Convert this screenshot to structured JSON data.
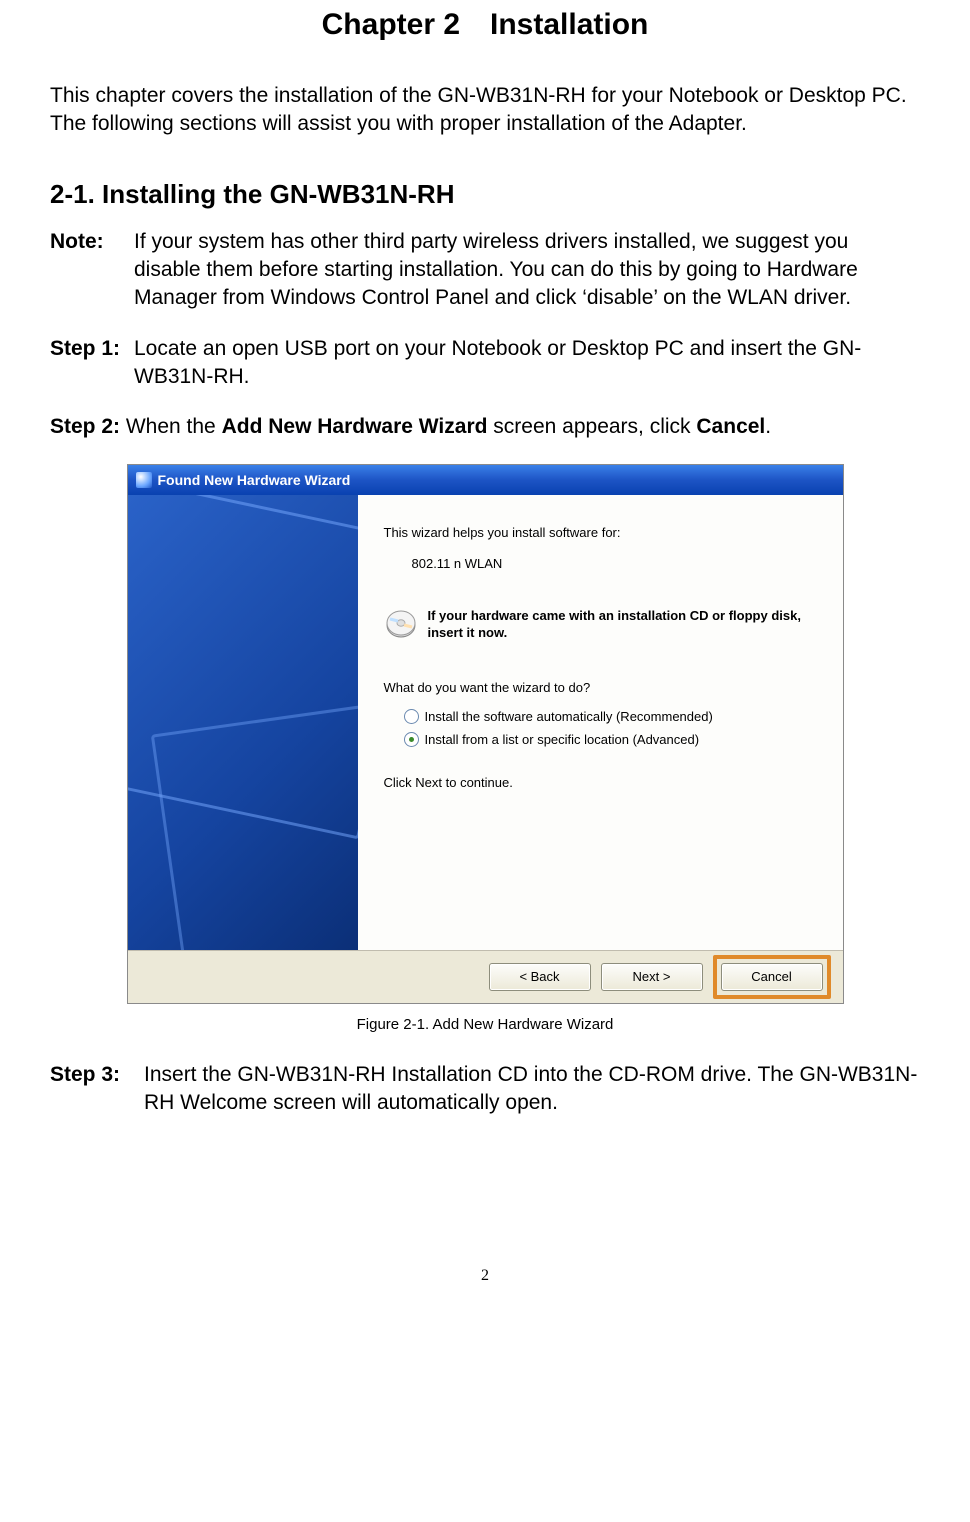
{
  "chapter_title": "Chapter 2 Installation",
  "intro": "This chapter covers the installation of the GN-WB31N-RH for your Notebook or Desktop PC. The following sections will assist you with proper installation of the Adapter.",
  "section_heading": "2-1.  Installing the GN-WB31N-RH",
  "note": {
    "label": "Note:",
    "text": "If your system has other third party wireless drivers installed, we suggest you disable them before starting installation. You can do this by going to Hardware Manager from Windows Control Panel and click ‘disable’ on the WLAN driver."
  },
  "step1": {
    "label": "Step 1:",
    "text": "Locate an open USB port on your Notebook or Desktop PC and insert the GN-WB31N-RH."
  },
  "step2": {
    "label": "Step 2:",
    "prefix": " When the ",
    "bold1": "Add New Hardware Wizard",
    "mid": " screen appears, click ",
    "bold2": "Cancel",
    "suffix": "."
  },
  "wizard": {
    "titlebar": "Found New Hardware Wizard",
    "line1": "This wizard helps you install software for:",
    "device": "802.11 n WLAN",
    "cd_text": "If your hardware came with an installation CD or floppy disk, insert it now.",
    "question": "What do you want the wizard to do?",
    "radio1": "Install the software automatically (Recommended)",
    "radio2": "Install from a list or specific location (Advanced)",
    "continue_text": "Click Next to continue.",
    "back_button": "< Back",
    "next_button": "Next >",
    "cancel_button": "Cancel"
  },
  "figure_caption": "Figure 2-1. Add New Hardware Wizard",
  "step3": {
    "label": "Step 3:",
    "text": "Insert the GN-WB31N-RH Installation CD into the CD-ROM drive. The GN-WB31N-RH Welcome screen will automatically open."
  },
  "page_number": "2"
}
